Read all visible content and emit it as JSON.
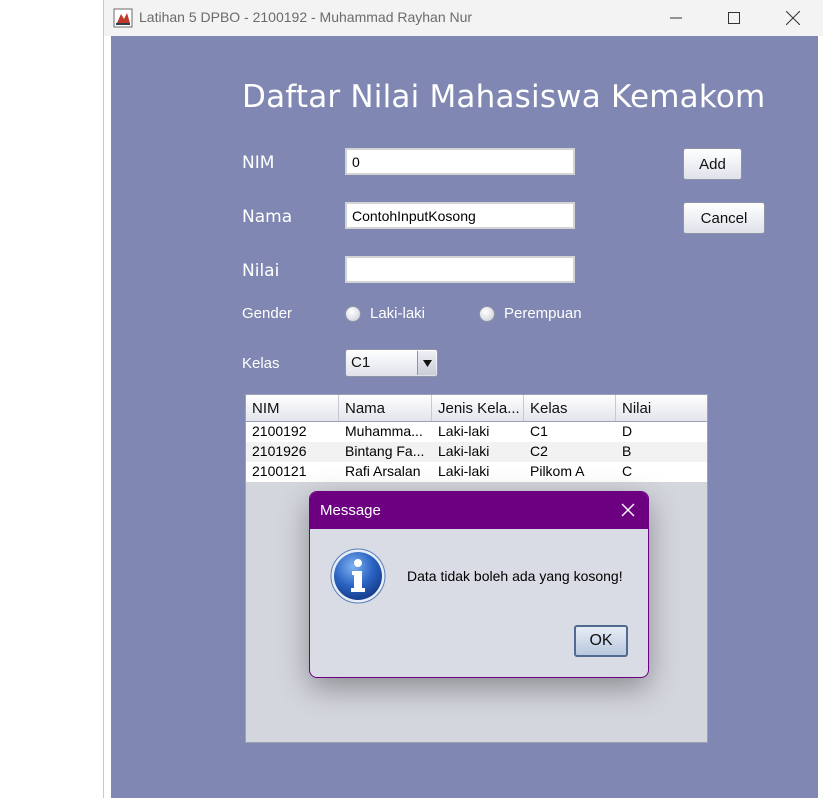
{
  "window": {
    "title": "Latihan 5 DPBO - 2100192 - Muhammad Rayhan Nur"
  },
  "form": {
    "heading": "Daftar Nilai Mahasiswa Kemakom",
    "nim_label": "NIM",
    "nim_value": "0",
    "nama_label": "Nama",
    "nama_value": "ContohInputKosong",
    "nilai_label": "Nilai",
    "nilai_value": "",
    "gender_label": "Gender",
    "gender_options": [
      "Laki-laki",
      "Perempuan"
    ],
    "kelas_label": "Kelas",
    "kelas_selected": "C1",
    "add_label": "Add",
    "cancel_label": "Cancel"
  },
  "table": {
    "columns": [
      "NIM",
      "Nama",
      "Jenis Kela...",
      "Kelas",
      "Nilai"
    ],
    "rows": [
      [
        "2100192",
        "Muhamma...",
        "Laki-laki",
        "C1",
        "D"
      ],
      [
        "2101926",
        "Bintang Fa...",
        "Laki-laki",
        "C2",
        "B"
      ],
      [
        "2100121",
        "Rafi Arsalan",
        "Laki-laki",
        "Pilkom A",
        "C"
      ]
    ]
  },
  "dialog": {
    "title": "Message",
    "message": "Data tidak boleh ada yang kosong!",
    "ok_label": "OK",
    "icon": "info-icon"
  },
  "colors": {
    "background": "#7f87b2",
    "dialog_titlebar": "#6d0080"
  }
}
